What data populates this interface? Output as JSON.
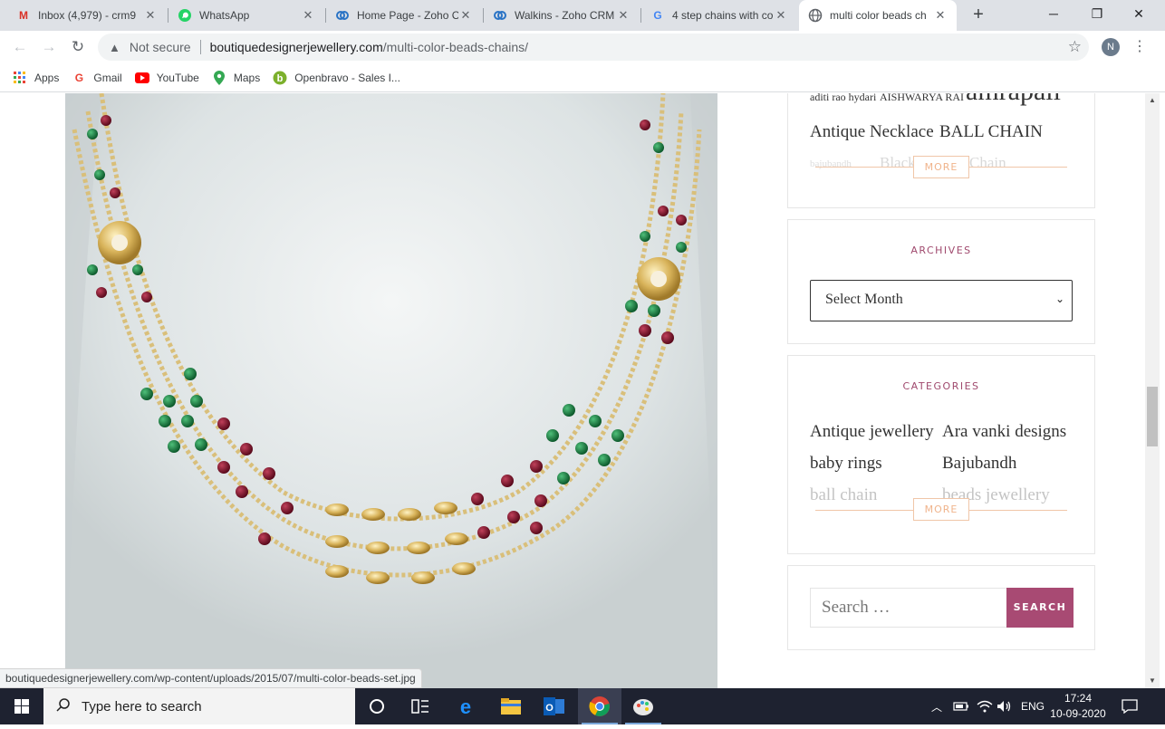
{
  "browser": {
    "tabs": [
      {
        "title": "Inbox (4,979) - crm9",
        "icon": "gmail-icon",
        "active": false
      },
      {
        "title": "WhatsApp",
        "icon": "whatsapp-icon",
        "active": false
      },
      {
        "title": "Home Page - Zoho C",
        "icon": "zoho-icon",
        "active": false
      },
      {
        "title": "Walkins - Zoho CRM",
        "icon": "zoho-icon",
        "active": false
      },
      {
        "title": "4 step chains with co",
        "icon": "google-icon",
        "active": false
      },
      {
        "title": "multi color beads ch",
        "icon": "globe-icon",
        "active": true
      }
    ],
    "new_tab": "+",
    "window_controls": {
      "minimize": "─",
      "maximize": "❐",
      "close": "✕"
    },
    "address": {
      "security_label": "Not secure",
      "host": "boutiquedesignerjewellery.com",
      "path": "/multi-color-beads-chains/"
    },
    "profile_initial": "N",
    "bookmarks": [
      {
        "label": "Apps",
        "icon": "apps-grid-icon"
      },
      {
        "label": "Gmail",
        "icon": "google-icon"
      },
      {
        "label": "YouTube",
        "icon": "youtube-icon"
      },
      {
        "label": "Maps",
        "icon": "maps-pin-icon"
      },
      {
        "label": "Openbravo - Sales I...",
        "icon": "openbravo-icon"
      }
    ],
    "status_url": "boutiquedesignerjewellery.com/wp-content/uploads/2015/07/multi-color-beads-set.jpg"
  },
  "sidebar": {
    "tags": {
      "items": [
        "aditi rao hydari",
        "AISHWARYA RAI",
        "amrapali",
        "Antique Necklace",
        "BALL CHAIN",
        "bajubandh",
        "Black",
        "Chain"
      ],
      "more_label": "MORE"
    },
    "archives": {
      "title": "ARCHIVES",
      "select_value": "Select Month"
    },
    "categories": {
      "title": "CATEGORIES",
      "items": [
        "Antique jewellery",
        "Ara vanki designs",
        "baby rings",
        "Bajubandh",
        "ball chain",
        "beads jewellery"
      ],
      "more_label": "MORE"
    },
    "search": {
      "placeholder": "Search …",
      "button_label": "SEARCH"
    }
  },
  "taskbar": {
    "search_placeholder": "Type here to search",
    "language": "ENG",
    "time": "17:24",
    "date": "10-09-2020"
  },
  "colors": {
    "accent": "#a84a73",
    "more_border": "#f0c6a8",
    "taskbar": "#1e2230"
  }
}
